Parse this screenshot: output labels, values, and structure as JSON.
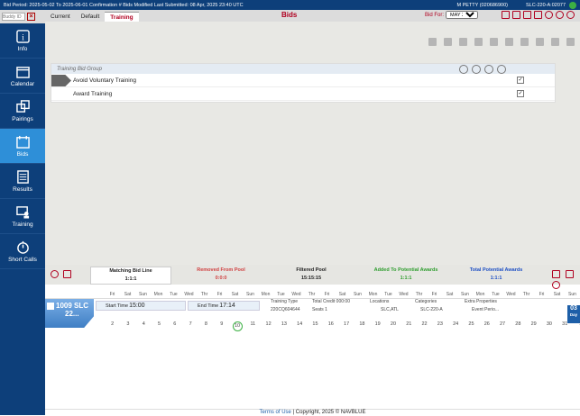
{
  "topbar": {
    "bid_period": "Bid Period: 2025-05-02 To 2025-06-01 Confirmation # Bids Modified Last Submitted: 08 Apr, 2025 23:40 UTC",
    "user": "M PETTY (020686900)",
    "station": "SLC-220-A:02077"
  },
  "sidebar": {
    "buddy_label": "Buddy ID",
    "items": [
      {
        "label": "Info",
        "icon": "info-icon"
      },
      {
        "label": "Calendar",
        "icon": "calendar-icon"
      },
      {
        "label": "Pairings",
        "icon": "pairings-icon"
      },
      {
        "label": "Bids",
        "icon": "bids-icon"
      },
      {
        "label": "Results",
        "icon": "results-icon"
      },
      {
        "label": "Training",
        "icon": "training-icon"
      },
      {
        "label": "Short Calls",
        "icon": "short-calls-icon"
      }
    ]
  },
  "tabs": [
    {
      "label": "Current"
    },
    {
      "label": "Default"
    },
    {
      "label": "Training"
    }
  ],
  "page_title": "Bids",
  "bid_for": {
    "label": "Bid For:",
    "selected": "MAY 2025"
  },
  "panel": {
    "header": "Training Bid Group",
    "rows": [
      {
        "label": "Avoid Voluntary Training",
        "checked": "✓"
      },
      {
        "label": "Award Training",
        "checked": "✓"
      }
    ]
  },
  "counts": {
    "matching": {
      "label": "Matching Bid Line",
      "value": "1:1:1"
    },
    "removed": {
      "label": "Removed From Pool",
      "value": "0:0:0",
      "color": "#d04040"
    },
    "filtered": {
      "label": "Filtered Pool",
      "value": "15:15:15"
    },
    "added": {
      "label": "Added To Potential Awards",
      "value": "1:1:1",
      "color": "#2e9d2e"
    },
    "total": {
      "label": "Total Potential Awards",
      "value": "1:1:1",
      "color": "#1d4fc4"
    }
  },
  "day_headers": [
    "Fri",
    "Sat",
    "Sun",
    "Mon",
    "Tue",
    "Wed",
    "Thr",
    "Fri",
    "Sat",
    "Sun",
    "Mon",
    "Tue",
    "Wed",
    "Thr",
    "Fri",
    "Sat",
    "Sun",
    "Mon",
    "Tue",
    "Wed",
    "Thr",
    "Fri",
    "Sat",
    "Sun",
    "Mon",
    "Tue",
    "Wed",
    "Thr",
    "Fri",
    "Sat",
    "Sun"
  ],
  "day_numbers": [
    "2",
    "3",
    "4",
    "5",
    "6",
    "7",
    "8",
    "9",
    "10",
    "11",
    "12",
    "13",
    "14",
    "15",
    "16",
    "17",
    "18",
    "19",
    "20",
    "21",
    "22",
    "23",
    "24",
    "25",
    "26",
    "27",
    "28",
    "29",
    "30",
    "31",
    "1"
  ],
  "trip": {
    "id": "1009 SLC",
    "sub": "22...",
    "start_label": "Start Time",
    "start_time": "15:00",
    "end_label": "End Time",
    "end_time": "17:14",
    "training_type_label": "Training Type",
    "training_type": "220CQ604644",
    "total_credit": "Total Credit 000:00",
    "seats": "Seats 1",
    "locations_label": "Locations",
    "locations": "SLC,ATL",
    "categories_label": "Categories",
    "categories": "SLC-220-A",
    "extra_label": "Extra Properties",
    "event_period": "Event Perio..."
  },
  "today": {
    "day": "03",
    "label": "Day"
  },
  "footer": {
    "terms": "Terms of Use",
    "copyright": "| Copyright, 2025 © NAVBLUE"
  }
}
